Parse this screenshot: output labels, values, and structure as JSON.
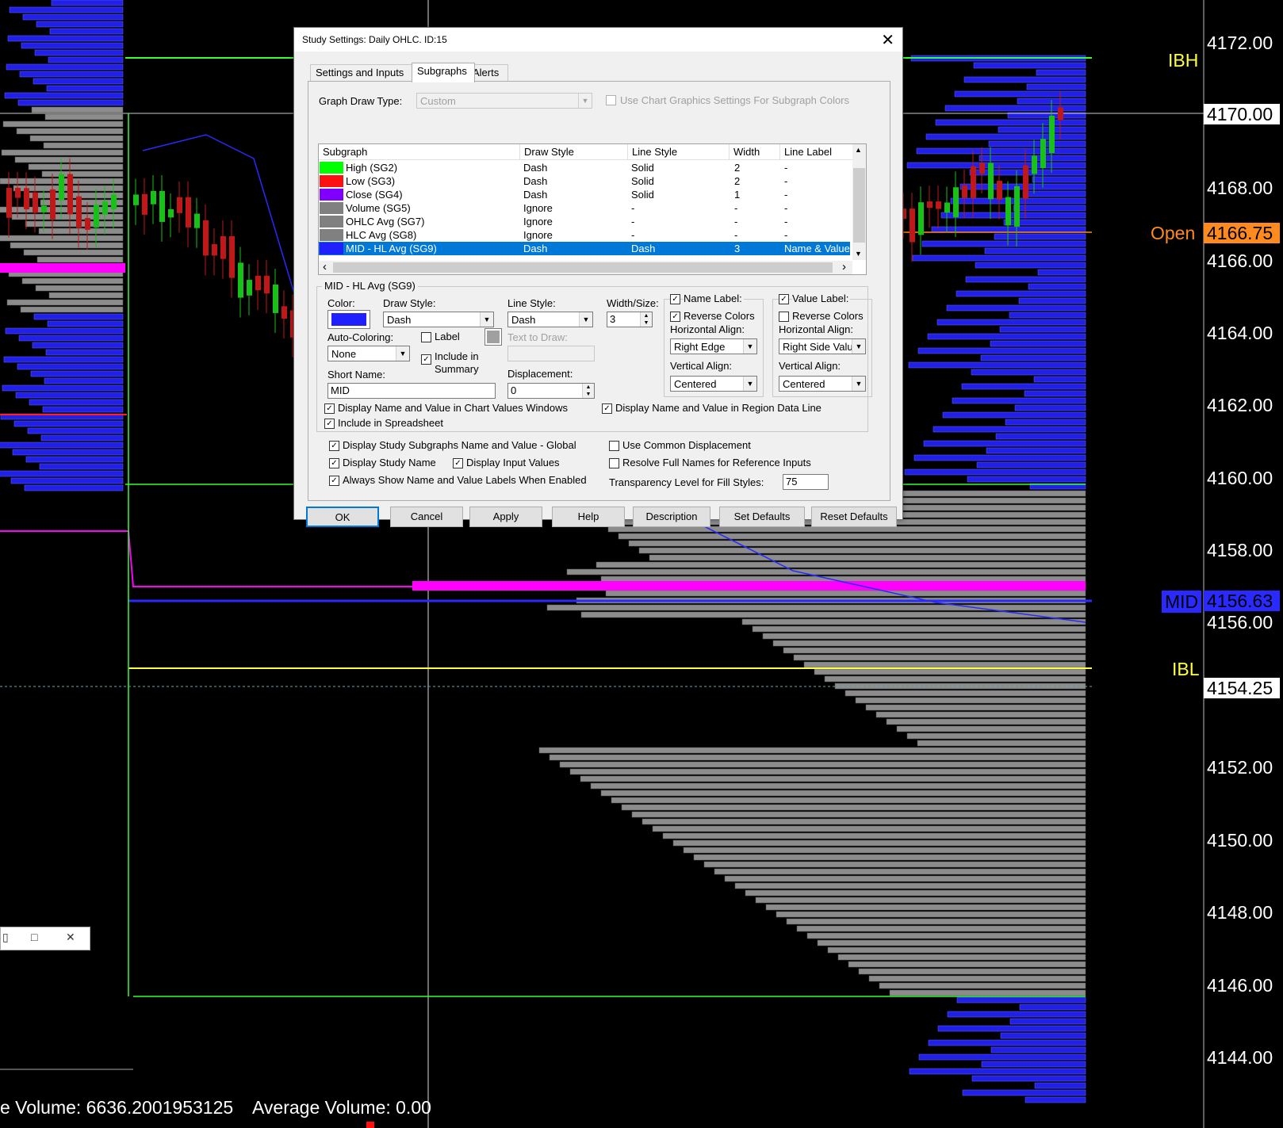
{
  "price_axis": {
    "labels": [
      "4172.00",
      "4170.00",
      "4168.00",
      "4166.75",
      "4166.00",
      "4164.00",
      "4162.00",
      "4160.00",
      "4158.00",
      "4156.63",
      "4156.00",
      "4154.25",
      "4152.00",
      "4150.00",
      "4148.00",
      "4146.00",
      "4144.00"
    ],
    "tags": {
      "ibh": "IBH",
      "open": "Open",
      "mid": "MID",
      "ibl": "IBL"
    },
    "colors": {
      "ibh": "#ffff40",
      "open": "#ff8a1f",
      "mid": "#2a2aff",
      "ibl": "#ffff40",
      "open_box": "#ff8a1f",
      "mid_box": "#2a2aff"
    }
  },
  "status_bar": {
    "volume": "e Volume: 6636.2001953125",
    "avg_volume": "Average Volume: 0.00"
  },
  "mini_window": {
    "min": "▯",
    "max": "□",
    "close": "✕"
  },
  "dialog": {
    "title": "Study Settings: Daily OHLC. ID:15",
    "close": "✕",
    "tabs": [
      "Settings and Inputs",
      "Subgraphs",
      "Alerts"
    ],
    "graph_draw_type_label": "Graph Draw Type:",
    "graph_draw_type_value": "Custom",
    "use_chart_graphics_label": "Use Chart Graphics Settings For Subgraph Colors",
    "grid": {
      "headers": [
        "Subgraph",
        "Draw Style",
        "Line Style",
        "Width",
        "Line Label"
      ],
      "rows": [
        {
          "name": "High (SG2)",
          "draw": "Dash",
          "line": "Solid",
          "width": "2",
          "label": "-",
          "color": "#00ff00"
        },
        {
          "name": "Low (SG3)",
          "draw": "Dash",
          "line": "Solid",
          "width": "2",
          "label": "-",
          "color": "#ff1010"
        },
        {
          "name": "Close (SG4)",
          "draw": "Dash",
          "line": "Solid",
          "width": "1",
          "label": "-",
          "color": "#8000ff"
        },
        {
          "name": "Volume (SG5)",
          "draw": "Ignore",
          "line": "-",
          "width": "-",
          "label": "-",
          "color": "#808080"
        },
        {
          "name": "OHLC Avg (SG7)",
          "draw": "Ignore",
          "line": "-",
          "width": "-",
          "label": "-",
          "color": "#808080"
        },
        {
          "name": "HLC Avg (SG8)",
          "draw": "Ignore",
          "line": "-",
          "width": "-",
          "label": "-",
          "color": "#808080"
        },
        {
          "name": "MID - HL Avg (SG9)",
          "draw": "Dash",
          "line": "Dash",
          "width": "3",
          "label": "Name & Value",
          "color": "#2020ff"
        }
      ],
      "up_arrow": "▲",
      "down_arrow": "▼",
      "left_arrow": "‹",
      "right_arrow": "›"
    },
    "group_title": "MID - HL Avg (SG9)",
    "color_label": "Color:",
    "color_value": "#2020ff",
    "draw_style_label": "Draw Style:",
    "draw_style_value": "Dash",
    "line_style_label": "Line Style:",
    "line_style_value": "Dash",
    "width_label": "Width/Size:",
    "width_value": "3",
    "auto_coloring_label": "Auto-Coloring:",
    "auto_coloring_value": "None",
    "label_cb": "Label",
    "text_to_draw_label": "Text to Draw:",
    "include_summary_1": "Include in",
    "include_summary_2": "Summary",
    "displacement_label": "Displacement:",
    "displacement_value": "0",
    "short_name_label": "Short Name:",
    "short_name_value": "MID",
    "name_label_group": "Name Label:",
    "name_reverse": "Reverse Colors",
    "name_h_align_label": "Horizontal Align:",
    "name_h_align_value": "Right Edge",
    "name_v_align_label": "Vertical Align:",
    "name_v_align_value": "Centered",
    "value_label_group": "Value Label:",
    "value_reverse": "Reverse Colors",
    "value_h_align_label": "Horizontal Align:",
    "value_h_align_value": "Right Side Valu",
    "value_v_align_label": "Vertical Align:",
    "value_v_align_value": "Centered",
    "display_chart_values": "Display Name and Value in Chart Values Windows",
    "display_region_line": "Display Name and Value in Region Data Line",
    "include_spreadsheet": "Include in Spreadsheet",
    "display_global": "Display Study Subgraphs Name and Value - Global",
    "use_common_disp": "Use Common Displacement",
    "display_study_name": "Display Study Name",
    "display_input_values": "Display Input Values",
    "resolve_full_names": "Resolve Full Names for Reference Inputs",
    "always_show": "Always Show Name and Value Labels When Enabled",
    "transparency_label": "Transparency Level for Fill Styles:",
    "transparency_value": "75",
    "check": "✓",
    "dropdown_arrow": "▼",
    "spin_up": "▲",
    "spin_down": "▼",
    "buttons": [
      "OK",
      "Cancel",
      "Apply",
      "Help",
      "Description",
      "Set Defaults",
      "Reset Defaults"
    ]
  }
}
